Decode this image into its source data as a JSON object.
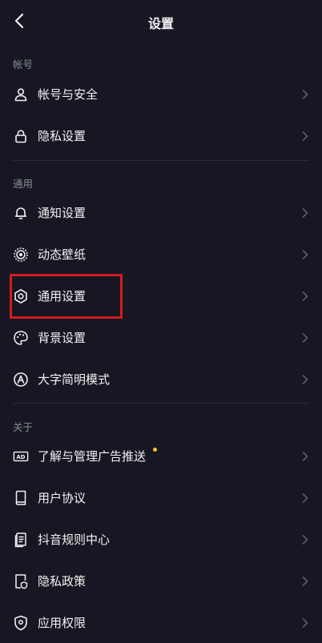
{
  "header": {
    "title": "设置",
    "back_icon": "chevron-left-icon"
  },
  "sections": [
    {
      "title": "帐号",
      "items": [
        {
          "label": "帐号与安全",
          "icon": "user-icon"
        },
        {
          "label": "隐私设置",
          "icon": "lock-icon"
        }
      ]
    },
    {
      "title": "通用",
      "items": [
        {
          "label": "通知设置",
          "icon": "bell-icon"
        },
        {
          "label": "动态壁纸",
          "icon": "live-wallpaper-icon"
        },
        {
          "label": "通用设置",
          "icon": "gear-icon",
          "highlighted": true
        },
        {
          "label": "背景设置",
          "icon": "palette-icon"
        },
        {
          "label": "大字简明模式",
          "icon": "font-a-icon"
        }
      ]
    },
    {
      "title": "关于",
      "items": [
        {
          "label": "了解与管理广告推送",
          "icon": "ad-icon",
          "badge_dot": true
        },
        {
          "label": "用户协议",
          "icon": "book-icon"
        },
        {
          "label": "抖音规则中心",
          "icon": "document-list-icon"
        },
        {
          "label": "隐私政策",
          "icon": "document-shield-icon"
        },
        {
          "label": "应用权限",
          "icon": "shield-icon"
        }
      ]
    }
  ],
  "colors": {
    "background": "#161722",
    "text": "#f2f2f2",
    "section_title": "#8a8b94",
    "divider": "#2a2b36",
    "chevron": "#5e5f68",
    "highlight_border": "#d51a22",
    "badge_dot": "#f5c518"
  }
}
